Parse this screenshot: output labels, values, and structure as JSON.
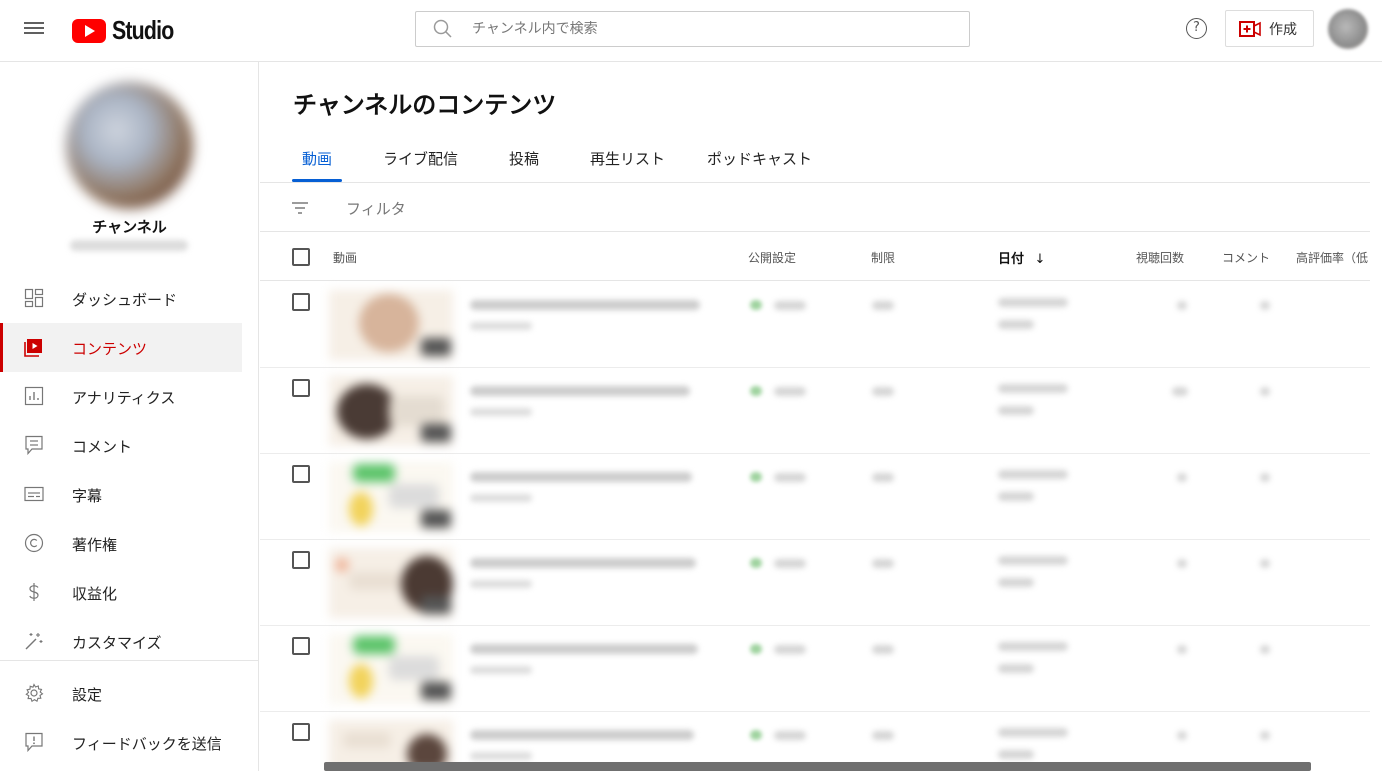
{
  "header": {
    "logo_text": "Studio",
    "search_placeholder": "チャンネル内で検索",
    "help_symbol": "?",
    "create_label": "作成"
  },
  "sidebar": {
    "channel_name": "チャンネル",
    "items": [
      {
        "label": "ダッシュボード",
        "icon": "dashboard-icon",
        "active": false
      },
      {
        "label": "コンテンツ",
        "icon": "content-icon",
        "active": true
      },
      {
        "label": "アナリティクス",
        "icon": "analytics-icon",
        "active": false
      },
      {
        "label": "コメント",
        "icon": "comment-icon",
        "active": false
      },
      {
        "label": "字幕",
        "icon": "subtitles-icon",
        "active": false
      },
      {
        "label": "著作権",
        "icon": "copyright-icon",
        "active": false
      },
      {
        "label": "収益化",
        "icon": "dollar-icon",
        "active": false
      },
      {
        "label": "カスタマイズ",
        "icon": "magic-wand-icon",
        "active": false
      }
    ],
    "footer_items": [
      {
        "label": "設定",
        "icon": "gear-icon"
      },
      {
        "label": "フィードバックを送信",
        "icon": "feedback-icon"
      }
    ]
  },
  "main": {
    "title": "チャンネルのコンテンツ",
    "tabs": [
      "動画",
      "ライブ配信",
      "投稿",
      "再生リスト",
      "ポッドキャスト"
    ],
    "active_tab": "動画",
    "filter_label": "フィルタ",
    "columns": {
      "video": "動画",
      "visibility": "公開設定",
      "restrictions": "制限",
      "date": "日付",
      "date_sort_arrow": "↓",
      "views": "視聴回数",
      "comments": "コメント",
      "likes": "高評価率（低"
    },
    "row_count": 6
  },
  "colors": {
    "accent_red": "#cc0000",
    "tab_blue": "#065fd4",
    "youtube_red": "#ff0000"
  }
}
